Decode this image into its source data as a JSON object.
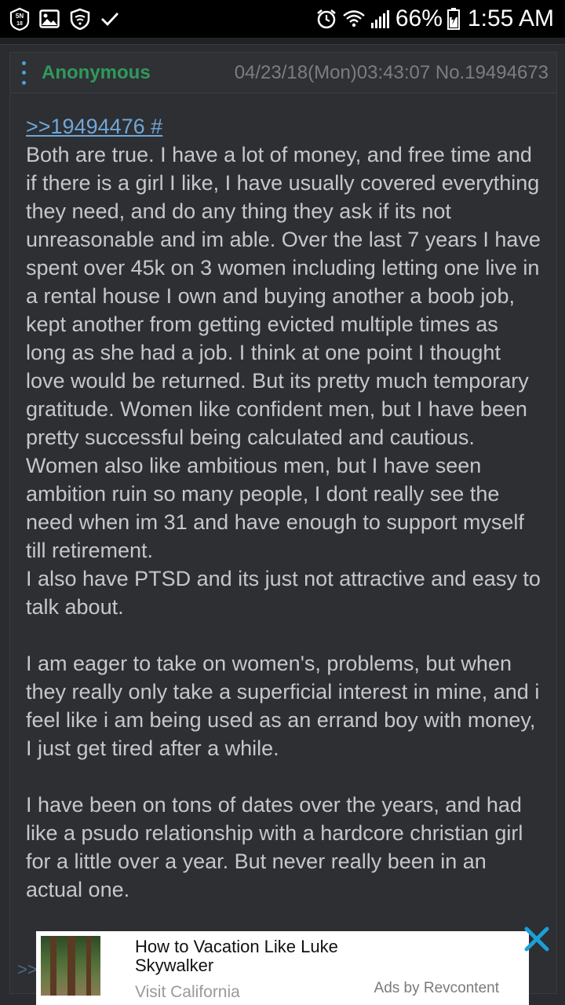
{
  "status_bar": {
    "battery_percent": "66%",
    "time": "1:55 AM",
    "icons_left": [
      "5n-badge-icon",
      "image-icon",
      "shield-icon",
      "check-icon"
    ],
    "icons_right": [
      "alarm-icon",
      "wifi-icon",
      "signal-icon",
      "battery-icon"
    ]
  },
  "post": {
    "name": "Anonymous",
    "meta": "04/23/18(Mon)03:43:07 No.19494673",
    "quote_link": ">>19494476 #",
    "paragraphs": [
      "Both are true. I have a lot of money, and free time and if there is a girl I like, I have usually covered everything they need, and do any thing they ask if its not unreasonable and im able. Over the last 7 years I have spent over 45k on 3 women including letting one live in a rental house I own and buying another a boob job, kept another from getting evicted multiple times as long as she had a job. I think at one point I thought love would be returned. But its pretty much temporary gratitude. Women like confident men, but I have been pretty successful being calculated and cautious. Women also like ambitious men, but I have seen ambition ruin so many people, I dont really see the need when im 31 and have enough to support myself till retirement.",
      "I also have PTSD and its just not attractive and easy to talk about.",
      "I am eager to take on women's, problems, but when they really only take a superficial interest in mine, and i feel like i am being used as an errand boy with money, I just get tired after a while.",
      "I have been on tons of dates over the years, and had like a psudo relationship with a hardcore christian girl for a little over a year. But never really been in an actual one."
    ]
  },
  "next_post_hint": ">>",
  "ad": {
    "title": "How to Vacation Like Luke Skywalker",
    "source": "Visit California",
    "by": "Ads by Revcontent",
    "close_color": "#1aa0d8"
  },
  "colors": {
    "background": "#2b2c30",
    "name_green": "#2e9a5c",
    "link_blue": "#6fa7d7",
    "text": "#c6c7c9"
  }
}
